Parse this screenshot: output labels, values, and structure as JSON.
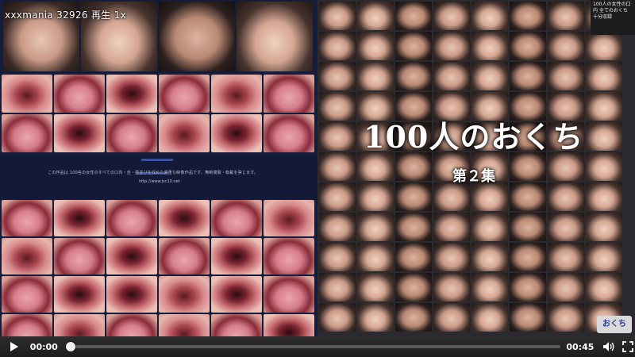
{
  "overlay": {
    "title": "xxxmania 32926 再生 1x"
  },
  "cover_left": {
    "band_text": "この作品は 100名の女性のすべての口内・舌・歯並びを収めた貴重な映像作品です。無断複製・転載を禁じます。",
    "band_url": "http://www.jsc10.net"
  },
  "cover_right": {
    "title": "100人のおくち",
    "subtitle": "第２集",
    "corner_text": "100人の女性の口内 全てのおくち 十分収録",
    "badge_text": "おくち"
  },
  "controls": {
    "play_icon": "play-icon",
    "current_time": "00:00",
    "duration": "00:45",
    "progress": 0,
    "volume_icon": "speaker-icon",
    "fullscreen_icon": "fullscreen-icon"
  },
  "colors": {
    "control_bar": "#262626",
    "track": "#5a5a5a",
    "left_cover_bg": "#161d3a"
  }
}
